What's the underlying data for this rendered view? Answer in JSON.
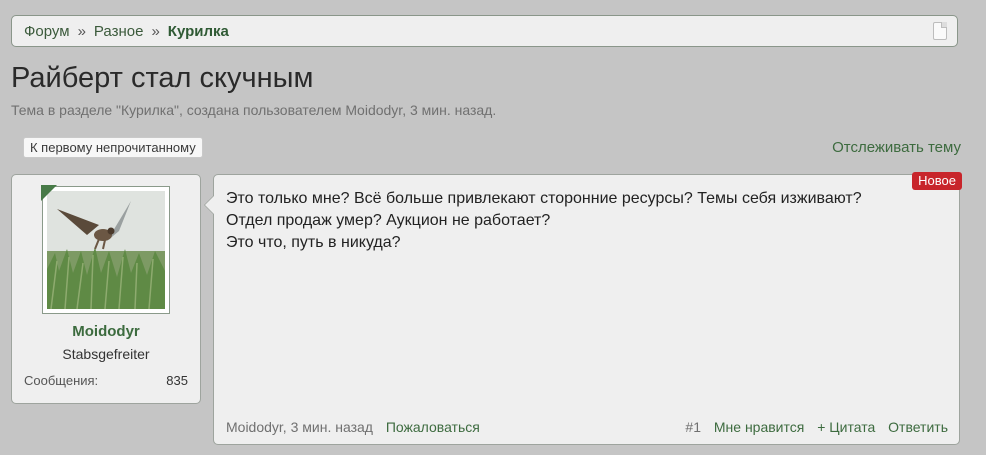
{
  "breadcrumb": {
    "items": [
      "Форум",
      "Разное"
    ],
    "separator": "»",
    "current": "Курилка"
  },
  "thread": {
    "title": "Райберт стал скучным",
    "meta": "Тема в разделе \"Курилка\", создана пользователем Moidodyr, 3 мин. назад."
  },
  "actions": {
    "first_unread": "К первому непрочитанному",
    "watch": "Отслеживать тему"
  },
  "user": {
    "name": "Moidodyr",
    "rank": "Stabsgefreiter",
    "messages_label": "Сообщения:",
    "messages_count": "835"
  },
  "post": {
    "badge": "Новое",
    "lines": [
      "Это только мне? Всё больше привлекают сторонние ресурсы? Темы себя изживают? Отдел продаж умер? Аукцион не работает?",
      "Это что, путь в никуда?"
    ],
    "author_time": "Moidodyr, 3 мин. назад",
    "report": "Пожаловаться",
    "number": "#1",
    "like": "Мне нравится",
    "quote": "+ Цитата",
    "reply": "Ответить"
  },
  "colors": {
    "accent": "#3d6b3f",
    "badge": "#c8252b",
    "background": "#c5c5c5"
  }
}
